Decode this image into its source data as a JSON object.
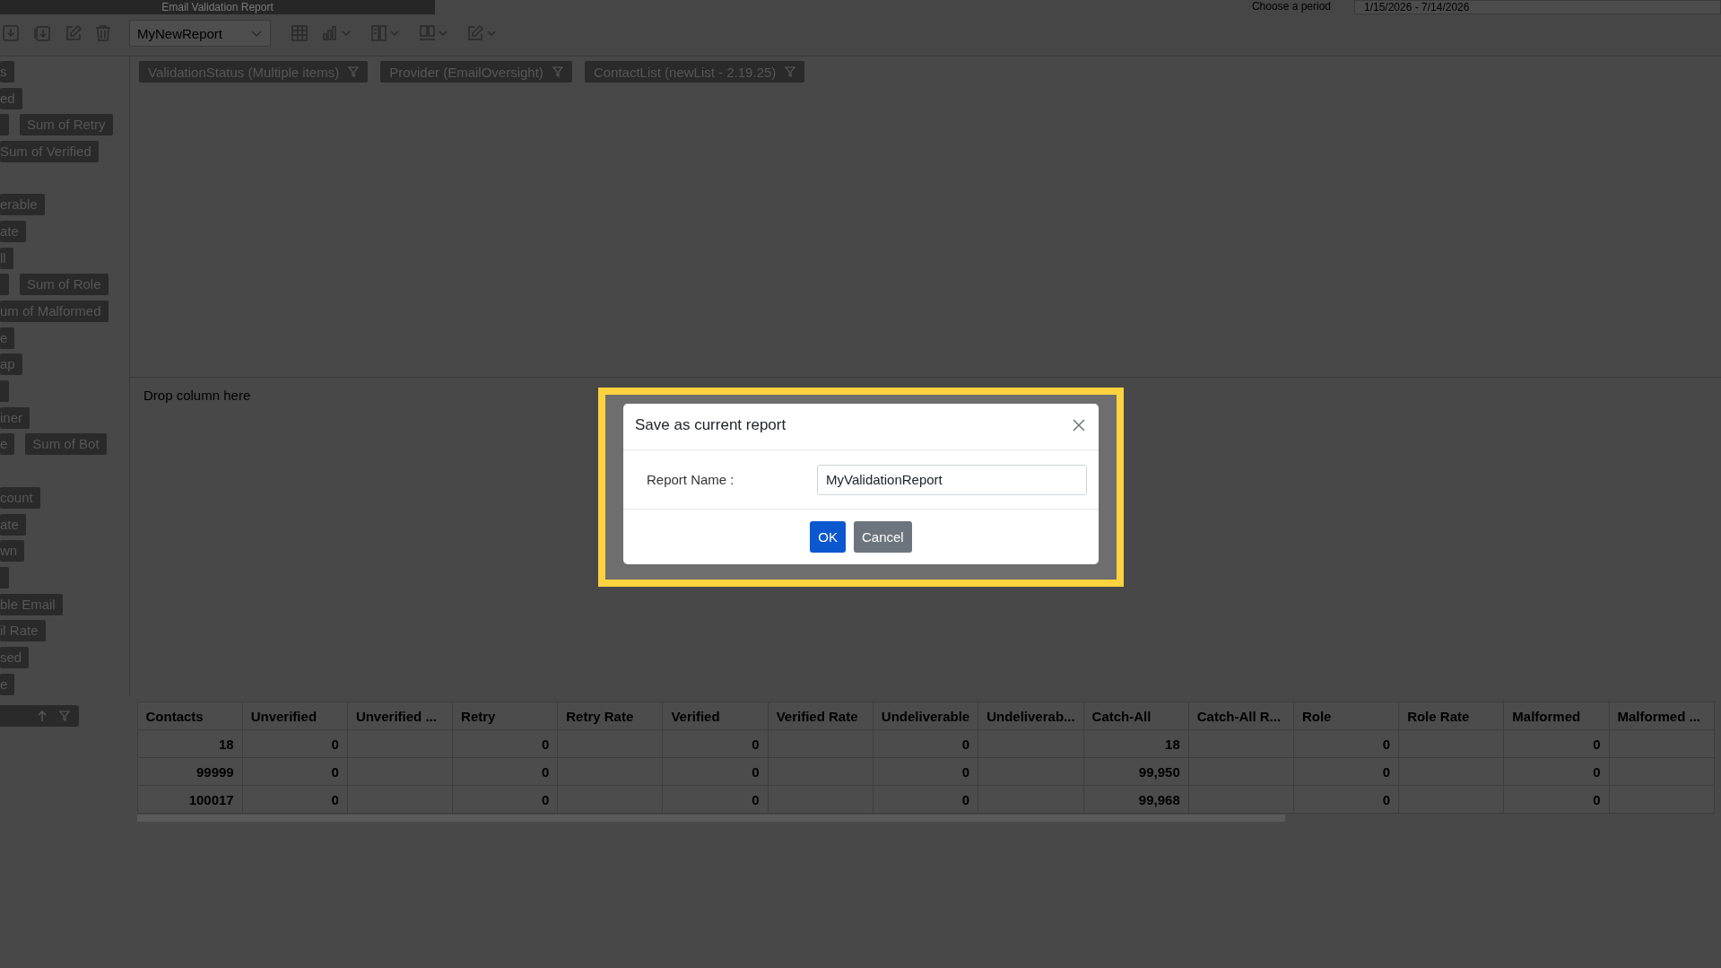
{
  "window": {
    "title": "Email Validation Report"
  },
  "period": {
    "label": "Choose a period",
    "value": "1/15/2026 - 7/14/2026"
  },
  "toolbar": {
    "report_select": "MyNewReport"
  },
  "field_list": {
    "rows": [
      {
        "kind": "chips",
        "chips": [
          {
            "kind": "field",
            "label": "s"
          }
        ]
      },
      {
        "kind": "chips",
        "chips": [
          {
            "kind": "field",
            "label": "ed"
          }
        ]
      },
      {
        "kind": "chips",
        "chips": [
          {
            "kind": "stub"
          },
          {
            "kind": "field",
            "label": "Sum of Retry"
          }
        ]
      },
      {
        "kind": "chips",
        "chips": [
          {
            "kind": "field",
            "label": "Sum of Verified"
          }
        ]
      },
      {
        "kind": "gap"
      },
      {
        "kind": "chips",
        "chips": [
          {
            "kind": "field",
            "label": "erable"
          }
        ]
      },
      {
        "kind": "chips",
        "chips": [
          {
            "kind": "field",
            "label": "ate"
          }
        ]
      },
      {
        "kind": "chips",
        "chips": [
          {
            "kind": "field",
            "label": "ll"
          }
        ]
      },
      {
        "kind": "chips",
        "chips": [
          {
            "kind": "stub"
          },
          {
            "kind": "field",
            "label": "Sum of Role"
          }
        ]
      },
      {
        "kind": "chips",
        "chips": [
          {
            "kind": "field",
            "label": "um of Malformed"
          }
        ]
      },
      {
        "kind": "chips",
        "chips": [
          {
            "kind": "field",
            "label": "e"
          }
        ]
      },
      {
        "kind": "chips",
        "chips": [
          {
            "kind": "field",
            "label": "ap"
          }
        ]
      },
      {
        "kind": "chips",
        "chips": [
          {
            "kind": "stub"
          }
        ]
      },
      {
        "kind": "chips",
        "chips": [
          {
            "kind": "field",
            "label": "iner"
          }
        ]
      },
      {
        "kind": "chips",
        "chips": [
          {
            "kind": "field",
            "label": "e"
          },
          {
            "kind": "field",
            "label": "Sum of Bot"
          }
        ]
      },
      {
        "kind": "gap"
      },
      {
        "kind": "chips",
        "chips": [
          {
            "kind": "field",
            "label": "count"
          }
        ]
      },
      {
        "kind": "chips",
        "chips": [
          {
            "kind": "field",
            "label": "ate"
          }
        ]
      },
      {
        "kind": "chips",
        "chips": [
          {
            "kind": "field",
            "label": "wn"
          }
        ]
      },
      {
        "kind": "chips",
        "chips": [
          {
            "kind": "stub"
          }
        ]
      },
      {
        "kind": "chips",
        "chips": [
          {
            "kind": "field",
            "label": "ble Email"
          }
        ]
      },
      {
        "kind": "chips",
        "chips": [
          {
            "kind": "field",
            "label": "il Rate"
          }
        ]
      },
      {
        "kind": "chips",
        "chips": [
          {
            "kind": "field",
            "label": "sed"
          }
        ]
      },
      {
        "kind": "chips",
        "chips": [
          {
            "kind": "field",
            "label": "e"
          }
        ]
      }
    ]
  },
  "filters": [
    {
      "label": "ValidationStatus (Multiple items)"
    },
    {
      "label": "Provider (EmailOversight)"
    },
    {
      "label": "ContactList (newList - 2.19.25)"
    }
  ],
  "column_drop": {
    "placeholder": "Drop column here"
  },
  "table": {
    "columns": [
      "Contacts",
      "Unverified",
      "Unverified ...",
      "Retry",
      "Retry Rate",
      "Verified",
      "Verified Rate",
      "Undeliverable",
      "Undeliverab...",
      "Catch-All",
      "Catch-All R...",
      "Role",
      "Role Rate",
      "Malformed",
      "Malformed ..."
    ],
    "rows": [
      [
        "18",
        "0",
        null,
        "0",
        null,
        "0",
        null,
        "0",
        null,
        "18",
        null,
        "0",
        null,
        "0",
        null
      ],
      [
        "99999",
        "0",
        null,
        "0",
        null,
        "0",
        null,
        "0",
        null,
        "99,950",
        null,
        "0",
        null,
        "0",
        null
      ],
      [
        "100017",
        "0",
        null,
        "0",
        null,
        "0",
        null,
        "0",
        null,
        "99,968",
        null,
        "0",
        null,
        "0",
        null
      ]
    ]
  },
  "dialog": {
    "title": "Save as current report",
    "field_label": "Report Name :",
    "value": "MyValidationReport",
    "buttons": [
      {
        "label": "OK",
        "kind": "primary"
      },
      {
        "label": "Cancel",
        "kind": "secondary"
      }
    ]
  }
}
